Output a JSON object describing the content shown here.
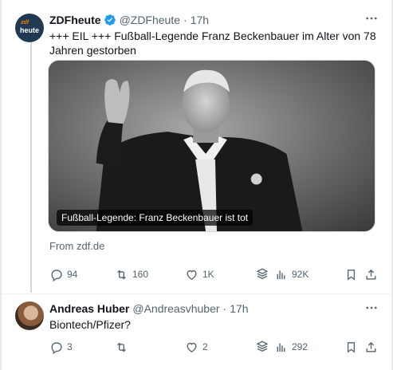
{
  "tweets": [
    {
      "avatar_text_top": "zdf",
      "avatar_text_bottom": "heute",
      "display_name": "ZDFheute",
      "handle": "@ZDFheute",
      "separator": "·",
      "time": "17h",
      "text": "+++ EIL +++ Fußball-Legende Franz Beckenbauer im Alter von 78 Jahren gestorben",
      "media_caption": "Fußball-Legende: Franz Beckenbauer ist tot",
      "link_source": "From zdf.de",
      "replies": "94",
      "retweets": "160",
      "likes": "1K",
      "views": "92K"
    },
    {
      "display_name": "Andreas Huber",
      "handle": "@Andreasvhuber",
      "separator": "·",
      "time": "17h",
      "text": "Biontech/Pfizer?",
      "replies": "3",
      "retweets": "",
      "likes": "2",
      "views": "292"
    }
  ],
  "icons": {
    "verified": "verified-badge-icon",
    "more": "more-dots-icon",
    "reply": "reply-icon",
    "retweet": "retweet-icon",
    "like": "heart-icon",
    "layers": "layers-icon",
    "views": "views-icon",
    "bookmark": "bookmark-icon",
    "share": "share-icon"
  },
  "colors": {
    "verified": "#1d9bf0",
    "text_primary": "#0f1419",
    "text_secondary": "#536471",
    "zdf_orange": "#f07d00",
    "zdf_blue": "#1f3a52"
  }
}
